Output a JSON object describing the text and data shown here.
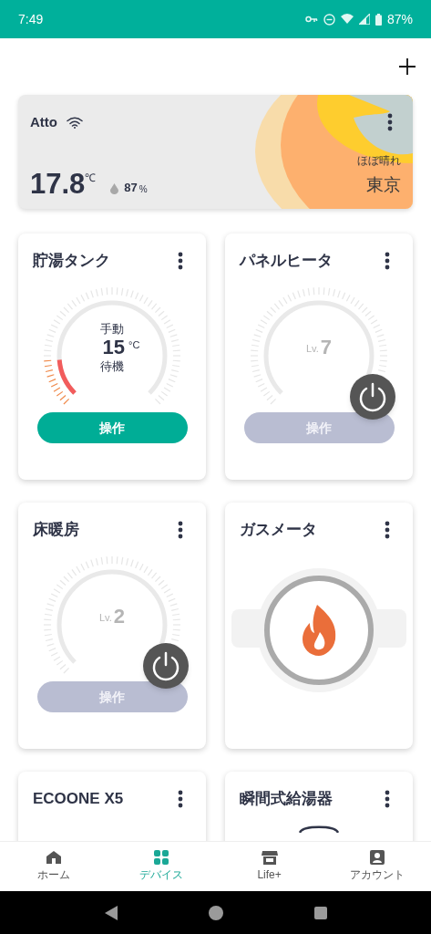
{
  "status_bar": {
    "time": "7:49",
    "battery": "87%"
  },
  "weather": {
    "name": "Atto",
    "temperature": "17.8",
    "temp_unit": "℃",
    "humidity": "87",
    "humidity_unit": "%",
    "condition": "ほぼ晴れ",
    "city": "東京"
  },
  "devices": [
    {
      "kind": "gauge",
      "title": "貯湯タンク",
      "on": true,
      "mode": "手動",
      "value": "15",
      "unit": "°C",
      "state": "待機",
      "button": "操作"
    },
    {
      "kind": "lv",
      "title": "パネルヒータ",
      "on": false,
      "lv_label": "Lv.",
      "value": "7",
      "button": "操作"
    },
    {
      "kind": "lv",
      "title": "床暖房",
      "on": false,
      "lv_label": "Lv.",
      "value": "2",
      "button": "操作"
    },
    {
      "kind": "gas",
      "title": "ガスメータ"
    },
    {
      "kind": "empty",
      "title": "ECOONE X5"
    },
    {
      "kind": "dial",
      "title": "瞬間式給湯器"
    }
  ],
  "nav": [
    {
      "label": "ホーム",
      "selected": false
    },
    {
      "label": "デバイス",
      "selected": true
    },
    {
      "label": "Life+",
      "selected": false
    },
    {
      "label": "アカウント",
      "selected": false
    }
  ]
}
